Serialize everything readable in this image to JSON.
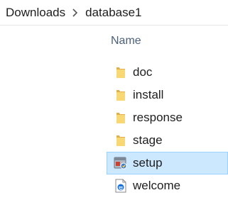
{
  "breadcrumb": {
    "items": [
      "Downloads",
      "database1"
    ]
  },
  "list": {
    "column_header": "Name",
    "items": [
      {
        "label": "doc",
        "type": "folder",
        "icon": "folder-icon",
        "selected": false
      },
      {
        "label": "install",
        "type": "folder",
        "icon": "folder-icon",
        "selected": false
      },
      {
        "label": "response",
        "type": "folder",
        "icon": "folder-icon",
        "selected": false
      },
      {
        "label": "stage",
        "type": "folder",
        "icon": "folder-icon",
        "selected": false
      },
      {
        "label": "setup",
        "type": "application",
        "icon": "setup-app-icon",
        "selected": true
      },
      {
        "label": "welcome",
        "type": "html-document",
        "icon": "edge-document-icon",
        "selected": false
      }
    ]
  },
  "colors": {
    "selection_background": "#cce8ff",
    "selection_border": "#99d1ff",
    "header_text": "#4c607a",
    "folder": "#f8d775"
  }
}
